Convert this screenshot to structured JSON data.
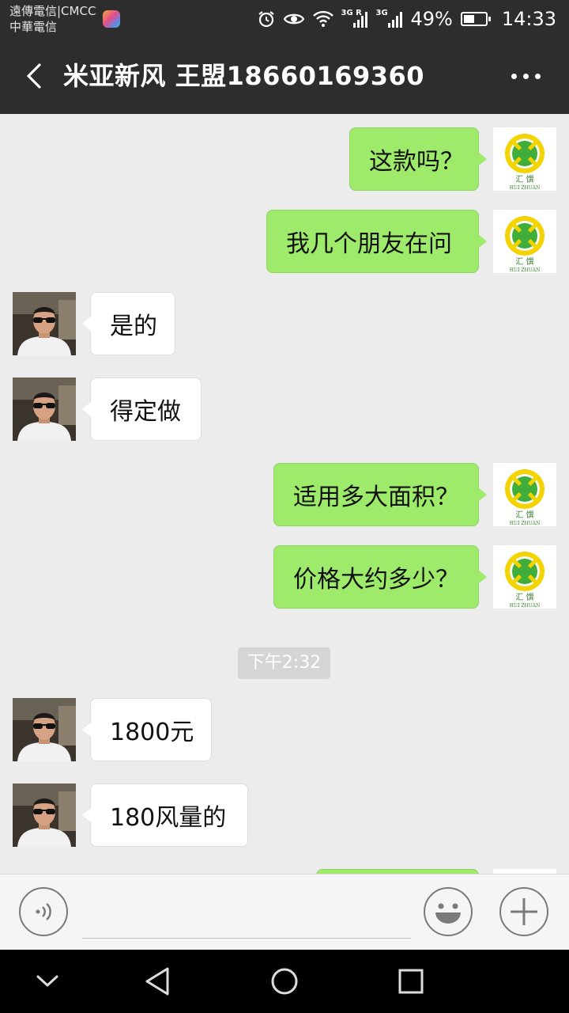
{
  "status_bar": {
    "carrier_line1": "遠傳電信|CMCC",
    "carrier_line2": "中華電信",
    "network1": "3G R",
    "network2": "3G",
    "battery_percent": "49%",
    "battery_level": 0.49,
    "time": "14:33",
    "icons": [
      "app-notification-icon",
      "alarm-icon",
      "eye-icon",
      "wifi-icon",
      "signal-icon",
      "signal-icon",
      "battery-icon"
    ]
  },
  "header": {
    "title": "米亚新风 王盟18660169360",
    "back_icon": "chevron-left-icon",
    "more_icon": "more-dots-icon"
  },
  "contact_avatar": {
    "right_logo_text": "汇  馔",
    "right_logo_subtext": "HUI ZHUAN"
  },
  "messages": [
    {
      "side": "right",
      "text": "这款吗？"
    },
    {
      "side": "right",
      "text": "我几个朋友在问"
    },
    {
      "side": "left",
      "text": "是的"
    },
    {
      "side": "left",
      "text": "得定做"
    },
    {
      "side": "right",
      "text": "适用多大面积？"
    },
    {
      "side": "right",
      "text": "价格大约多少？"
    },
    {
      "side": "left",
      "text": "1800元"
    },
    {
      "side": "left",
      "text": "180风量的"
    },
    {
      "side": "right",
      "text": ""
    }
  ],
  "timestamp": "下午2:32",
  "input_bar": {
    "icons": [
      "voice-icon",
      "emoji-icon",
      "plus-icon"
    ]
  },
  "nav_bar": {
    "icons": [
      "chevron-down-icon",
      "back-triangle-icon",
      "home-circle-icon",
      "recents-square-icon"
    ]
  },
  "colors": {
    "header_bg": "#2d2d2d",
    "chat_bg": "#ececec",
    "sent_bubble": "#9eea6a",
    "received_bubble": "#ffffff"
  }
}
